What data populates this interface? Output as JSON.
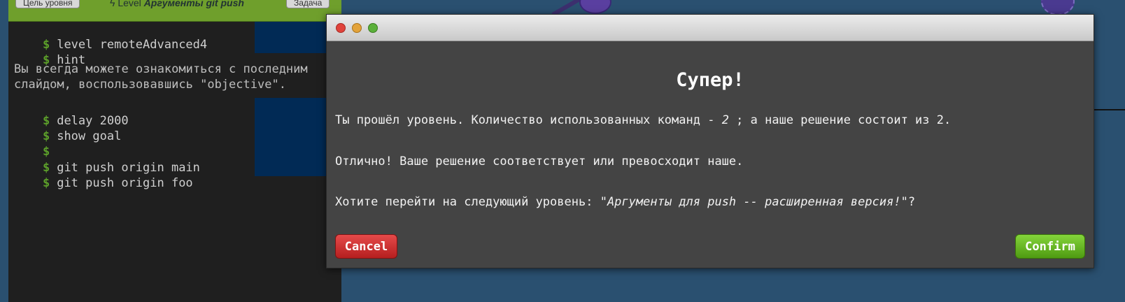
{
  "header": {
    "goal_button": "Цель уровня",
    "level_prefix": "Level",
    "level_name": "Аргументы git push",
    "task_button": "Задача"
  },
  "terminal": {
    "prompt": "$",
    "commands_top": [
      "level remoteAdvanced4",
      "hint"
    ],
    "hint": "Вы всегда можете ознакомиться с последним слайдом, воспользовавшись \"objective\".",
    "commands_bottom": [
      "delay 2000",
      "show goal",
      "",
      "git push origin main",
      "git push origin foo"
    ]
  },
  "modal": {
    "heading": "Супер!",
    "line1_prefix": "Ты прошёл уровень. Количество использованных команд - ",
    "line1_count": "2",
    "line1_suffix": " ; а наше решение состоит из 2.",
    "line2": "Отлично! Ваше решение соответствует или превосходит наше.",
    "line3_prefix": "Хотите перейти на следующий уровень: ",
    "line3_level": "\"Аргументы для push -- расширенная версия!\"",
    "line3_suffix": "?",
    "cancel_label": "Cancel",
    "confirm_label": "Confirm"
  },
  "colors": {
    "background": "#2a5070",
    "terminal": "#1f1f1f",
    "header": "#6f9f2c",
    "modal": "#444444",
    "cancel": "#c82a2a",
    "confirm": "#6cbf24"
  }
}
